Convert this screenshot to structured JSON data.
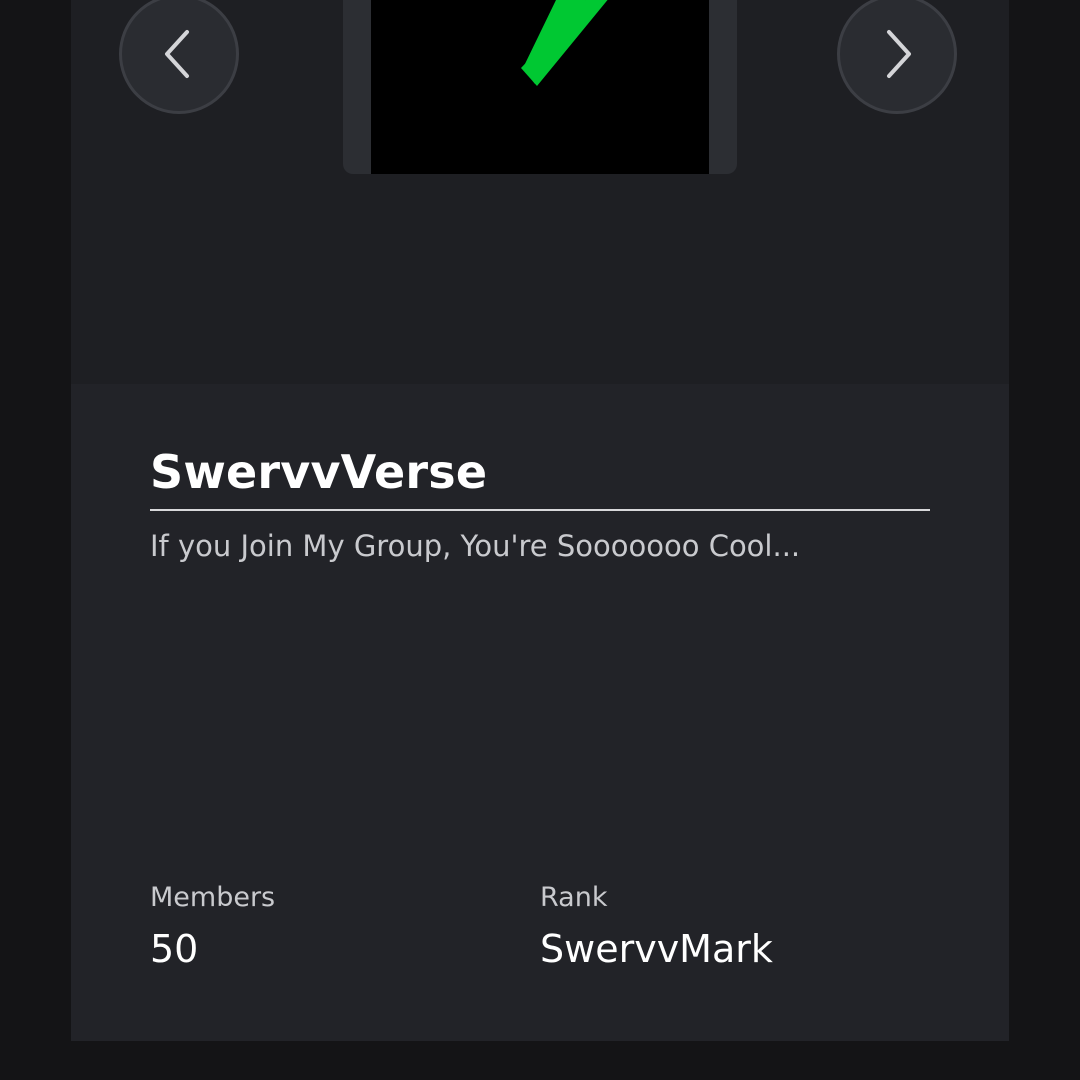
{
  "carousel": {
    "prev_icon": "chevron-left-icon",
    "next_icon": "chevron-right-icon",
    "thumbnail_accent": "#00c832"
  },
  "group": {
    "name": "SwervvVerse",
    "description": "If you Join My Group, You're Sooooooo Cool..."
  },
  "stats": {
    "members_label": "Members",
    "members_value": "50",
    "rank_label": "Rank",
    "rank_value": "SwervvMark"
  },
  "colors": {
    "background": "#141416",
    "card": "#1e1f23",
    "info_panel": "#222328",
    "text_primary": "#ffffff",
    "text_secondary": "#c9cace"
  }
}
